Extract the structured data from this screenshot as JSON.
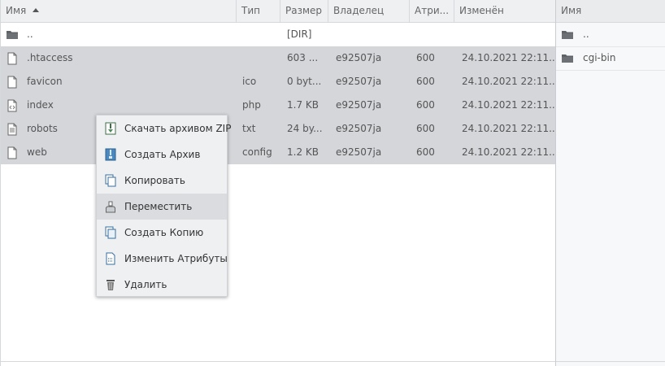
{
  "file_table": {
    "headers": {
      "name": "Имя",
      "type": "Тип",
      "size": "Размер",
      "owner": "Владелец",
      "attrs": "Атри...",
      "modified": "Изменён"
    },
    "rows": [
      {
        "name": "..",
        "type": "",
        "size": "[DIR]",
        "owner": "",
        "attrs": "",
        "modified": "",
        "icon": "folder-icon",
        "selected": false
      },
      {
        "name": ".htaccess",
        "type": "",
        "size": "603 ...",
        "owner": "e92507ja",
        "attrs": "600",
        "modified": "24.10.2021 22:11...",
        "icon": "file-icon",
        "selected": true
      },
      {
        "name": "favicon",
        "type": "ico",
        "size": "0 byt...",
        "owner": "e92507ja",
        "attrs": "600",
        "modified": "24.10.2021 22:11...",
        "icon": "file-icon",
        "selected": true
      },
      {
        "name": "index",
        "type": "php",
        "size": "1.7 KB",
        "owner": "e92507ja",
        "attrs": "600",
        "modified": "24.10.2021 22:11...",
        "icon": "code-file-icon",
        "selected": true
      },
      {
        "name": "robots",
        "type": "txt",
        "size": "24 by...",
        "owner": "e92507ja",
        "attrs": "600",
        "modified": "24.10.2021 22:11...",
        "icon": "text-file-icon",
        "selected": true
      },
      {
        "name": "web",
        "type": "config",
        "size": "1.2 KB",
        "owner": "e92507ja",
        "attrs": "600",
        "modified": "24.10.2021 22:11...",
        "icon": "file-icon",
        "selected": true
      }
    ]
  },
  "right_panel": {
    "header": "Имя",
    "rows": [
      {
        "name": "..",
        "icon": "folder-icon"
      },
      {
        "name": "cgi-bin",
        "icon": "folder-icon"
      }
    ]
  },
  "context_menu": {
    "items": [
      {
        "label": "Скачать архивом ZIP",
        "icon": "zip-archive-icon"
      },
      {
        "label": "Создать Архив",
        "icon": "archive-icon"
      },
      {
        "label": "Копировать",
        "icon": "copy-icon"
      },
      {
        "label": "Переместить",
        "icon": "move-icon",
        "hovered": true
      },
      {
        "label": "Создать Копию",
        "icon": "duplicate-icon"
      },
      {
        "label": "Изменить Атрибуты",
        "icon": "attributes-icon"
      },
      {
        "label": "Удалить",
        "icon": "trash-icon"
      }
    ]
  },
  "colors": {
    "selection": "#d4d6da",
    "header_bg": "#eef0f2",
    "menu_bg": "#eef0f2",
    "menu_hover": "#dadcdf"
  }
}
